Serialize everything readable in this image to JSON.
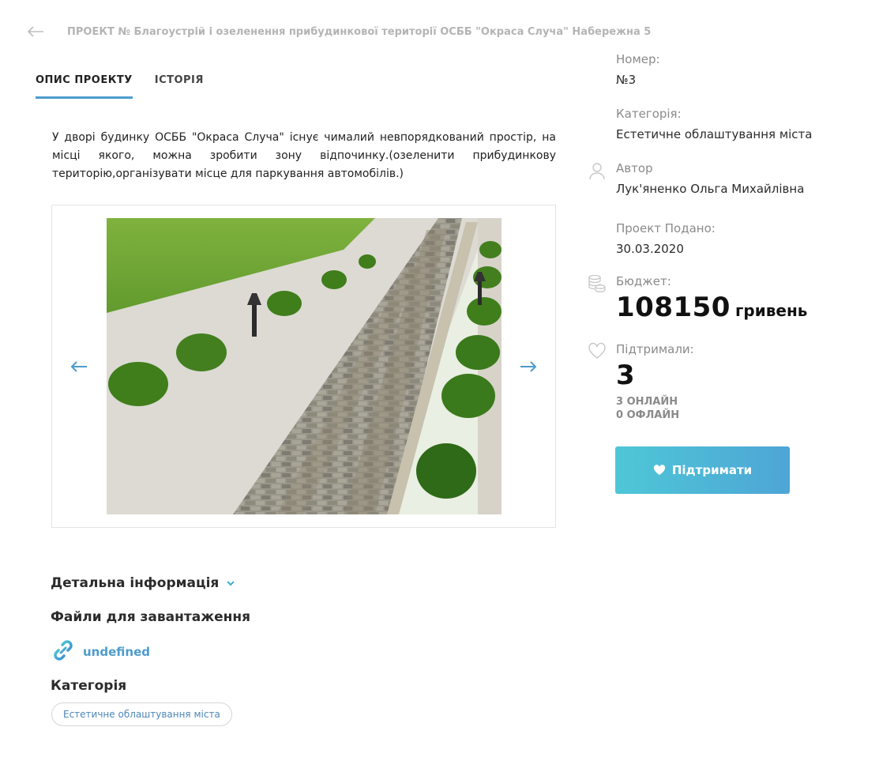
{
  "header": {
    "title": "ПРОЕКТ № Благоустрій і озеленення прибудинкової території ОСББ \"Окраса Случа\" Набережна 5"
  },
  "tabs": [
    {
      "label": "ОПИС ПРОЕКТУ",
      "active": true
    },
    {
      "label": "ІСТОРІЯ",
      "active": false
    }
  ],
  "description": "У дворі будинку ОСББ \"Окраса Случа\" існує чималий невпорядкований простір, на місці якого, можна зробити зону відпочинку.(озеленити прибудинкову територію,організувати місце для паркування автомобілів.)",
  "details": {
    "detail_label": "Детальна інформація",
    "files_label": "Файли для завантаження",
    "file_link": "undefined",
    "category_label": "Категорія",
    "category_chip": "Естетичне облаштування міста"
  },
  "sidebar": {
    "number_label": "Номер:",
    "number_value": "№3",
    "category_label": "Категорія:",
    "category_value": "Естетичне облаштування міста",
    "author_label": "Автор",
    "author_value": "Лук'яненко Ольга Михайлівна",
    "submitted_label": "Проект Подано:",
    "submitted_value": "30.03.2020",
    "budget_label": "Бюджет:",
    "budget_value": "108150",
    "budget_unit": "гривень",
    "supported_label": "Підтримали:",
    "supported_value": "3",
    "online": "3 ОНЛАЙН",
    "offline": "0 ОФЛАЙН",
    "support_button": "Підтримати"
  },
  "colors": {
    "accent": "#4d9ccd",
    "button_start": "#4ec7d6",
    "button_end": "#4ea5d6"
  }
}
